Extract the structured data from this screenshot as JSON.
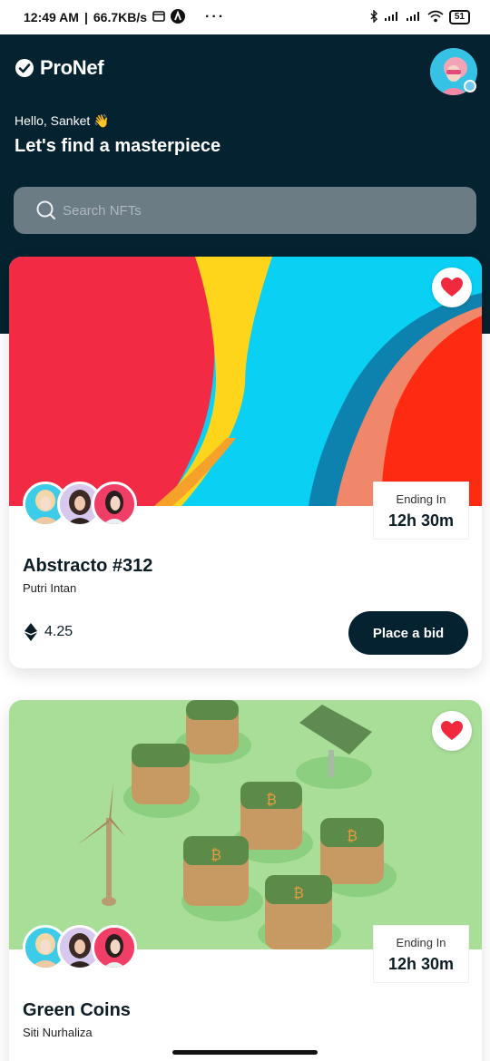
{
  "status": {
    "time": "12:49 AM",
    "speed": "66.7KB/s",
    "dots": "···",
    "battery": "51"
  },
  "app": {
    "name": "ProNef",
    "greeting": "Hello, Sanket 👋",
    "headline": "Let's find a masterpiece",
    "search_placeholder": "Search NFTs"
  },
  "cards": [
    {
      "title": "Abstracto #312",
      "creator": "Putri Intan",
      "ending_label": "Ending In",
      "ending_value": "12h 30m",
      "price": "4.25",
      "bid_label": "Place a bid"
    },
    {
      "title": "Green Coins",
      "creator": "Siti Nurhaliza",
      "ending_label": "Ending In",
      "ending_value": "12h 30m"
    }
  ],
  "colors": {
    "header": "#052230",
    "accent": "#f1293f",
    "button": "#052230"
  }
}
